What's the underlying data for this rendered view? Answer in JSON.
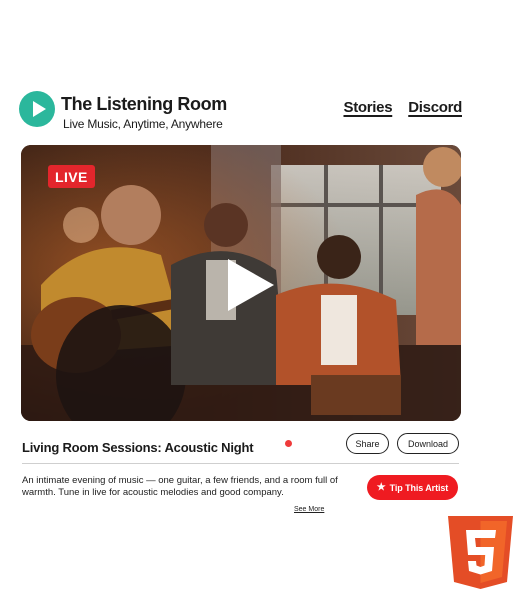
{
  "brand": {
    "title": "The Listening Room",
    "tagline": "Live Music, Anytime, Anywhere",
    "logo_icon": "play-icon",
    "accent_color": "#2bb79c"
  },
  "nav": {
    "items": [
      {
        "label": "Stories"
      },
      {
        "label": "Discord"
      }
    ]
  },
  "video": {
    "live_badge": "LIVE",
    "play_icon": "play-icon",
    "live_color": "#e3262c"
  },
  "stream": {
    "title": "Living Room Sessions: Acoustic Night",
    "status_dot_color": "#ef3b3b",
    "share_label": "Share",
    "download_label": "Download",
    "description": "An intimate evening of music — one guitar, a few friends, and a room full of warmth. Tune in live for acoustic melodies and good company.",
    "see_more_label": "See More",
    "tip_label": "Tip This Artist",
    "tip_icon": "star-icon",
    "tip_color": "#ef1b21"
  },
  "badge": {
    "icon": "html5-logo",
    "text": "5"
  }
}
